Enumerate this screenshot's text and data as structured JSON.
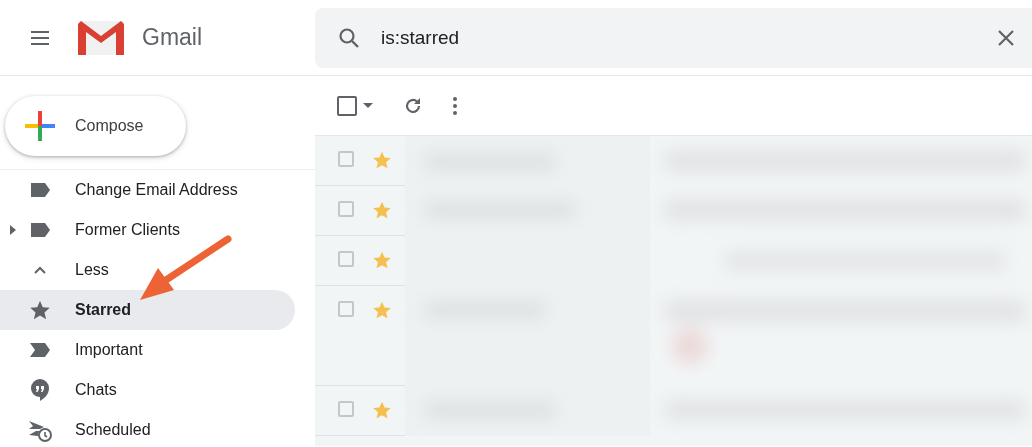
{
  "header": {
    "app_name": "Gmail",
    "search": {
      "value": "is:starred"
    }
  },
  "compose": {
    "label": "Compose"
  },
  "sidebar": {
    "items": [
      {
        "label": "Change Email Address",
        "kind": "label",
        "selected": false,
        "expandable": false
      },
      {
        "label": "Former Clients",
        "kind": "label",
        "selected": false,
        "expandable": true
      },
      {
        "label": "Less",
        "kind": "less",
        "selected": false,
        "expandable": false
      },
      {
        "label": "Starred",
        "kind": "starred",
        "selected": true,
        "expandable": false
      },
      {
        "label": "Important",
        "kind": "important",
        "selected": false,
        "expandable": false
      },
      {
        "label": "Chats",
        "kind": "chats",
        "selected": false,
        "expandable": false
      },
      {
        "label": "Scheduled",
        "kind": "scheduled",
        "selected": false,
        "expandable": false
      }
    ]
  },
  "toolbar": {
    "select_all_checked": false
  },
  "messages": [
    {
      "checked": false,
      "starred": true,
      "tall": false
    },
    {
      "checked": false,
      "starred": true,
      "tall": false
    },
    {
      "checked": false,
      "starred": true,
      "tall": false
    },
    {
      "checked": false,
      "starred": true,
      "tall": true
    },
    {
      "checked": false,
      "starred": true,
      "tall": false
    }
  ],
  "annotation": {
    "kind": "arrow"
  }
}
